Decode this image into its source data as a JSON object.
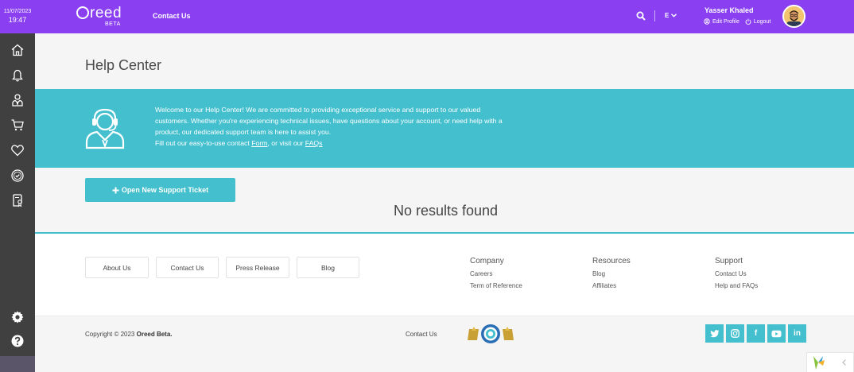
{
  "topbar": {
    "date": "11/07/2023",
    "time": "19:47",
    "logo_text": "reed",
    "logo_beta": "BETA",
    "contact_link": "Contact Us",
    "language": "E",
    "user_name": "Yasser Khaled",
    "edit_profile": "Edit Profile",
    "logout": "Logout"
  },
  "sidebar": {
    "items": [
      "home-icon",
      "bell-icon",
      "user-tie-icon",
      "cart-icon",
      "heart-icon",
      "badge-check-icon",
      "certificate-icon"
    ],
    "bottom_items": [
      "gear-icon",
      "help-icon"
    ]
  },
  "main": {
    "title": "Help Center",
    "banner": {
      "line1": "Welcome to our Help Center! We are committed to providing exceptional service and support to our valued customers. Whether you're experiencing technical issues, have questions about your account, or need help with a product, our dedicated support team is here to assist you.",
      "line2_prefix": "Fill out our easy-to-use contact ",
      "form_link": "Form",
      "line2_middle": ", or visit our ",
      "faqs_link": "FAQs"
    },
    "ticket_button": "Open New Support Ticket",
    "no_results": "No results found"
  },
  "footer": {
    "buttons": [
      "About Us",
      "Contact Us",
      "Press Release",
      "Blog"
    ],
    "columns": [
      {
        "heading": "Company",
        "items": [
          "Careers",
          "Term of Reference"
        ]
      },
      {
        "heading": "Resources",
        "items": [
          "Blog",
          "Affiliates"
        ]
      },
      {
        "heading": "Support",
        "items": [
          "Contact Us",
          "Help and FAQs"
        ]
      }
    ],
    "copyright_prefix": "Copyright © 2023 ",
    "copyright_brand": "Oreed Beta.",
    "bottom_contact": "Contact Us",
    "socials": [
      "twitter-icon",
      "instagram-icon",
      "facebook-icon",
      "youtube-icon",
      "linkedin-icon"
    ],
    "social_labels": [
      "f",
      "in"
    ]
  },
  "colors": {
    "topbar": "#8a3ff0",
    "accent": "#43bfce",
    "sidebar": "#404040"
  }
}
